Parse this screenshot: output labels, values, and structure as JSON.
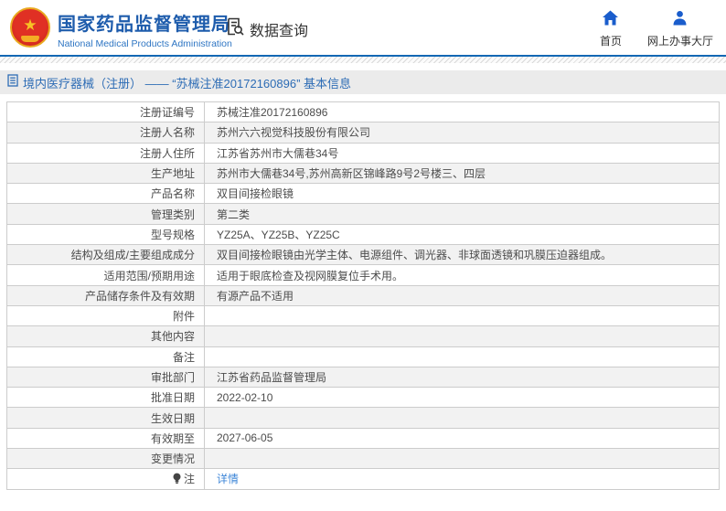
{
  "header": {
    "org_name_cn": "国家药品监督管理局",
    "org_name_en": "National Medical Products Administration",
    "section_title": "数据查询",
    "nav": [
      {
        "label": "首页"
      },
      {
        "label": "网上办事大厅"
      }
    ]
  },
  "breadcrumb": {
    "text": "境内医疗器械（注册） —— “苏械注准20172160896” 基本信息"
  },
  "table": {
    "rows": [
      {
        "label": "注册证编号",
        "value": "苏械注准20172160896"
      },
      {
        "label": "注册人名称",
        "value": "苏州六六视觉科技股份有限公司"
      },
      {
        "label": "注册人住所",
        "value": "江苏省苏州市大儒巷34号"
      },
      {
        "label": "生产地址",
        "value": "苏州市大儒巷34号,苏州高新区锦峰路9号2号楼三、四层"
      },
      {
        "label": "产品名称",
        "value": "双目间接检眼镜"
      },
      {
        "label": "管理类别",
        "value": "第二类"
      },
      {
        "label": "型号规格",
        "value": "YZ25A、YZ25B、YZ25C"
      },
      {
        "label": "结构及组成/主要组成成分",
        "value": "双目间接检眼镜由光学主体、电源组件、调光器、非球面透镜和巩膜压迫器组成。"
      },
      {
        "label": "适用范围/预期用途",
        "value": "适用于眼底检查及视网膜复位手术用。"
      },
      {
        "label": "产品储存条件及有效期",
        "value": "有源产品不适用"
      },
      {
        "label": "附件",
        "value": ""
      },
      {
        "label": "其他内容",
        "value": ""
      },
      {
        "label": "备注",
        "value": ""
      },
      {
        "label": "审批部门",
        "value": "江苏省药品监督管理局"
      },
      {
        "label": "批准日期",
        "value": "2022-02-10"
      },
      {
        "label": "生效日期",
        "value": ""
      },
      {
        "label": "有效期至",
        "value": "2027-06-05"
      },
      {
        "label": "变更情况",
        "value": ""
      },
      {
        "label": "注",
        "value": "详情",
        "icon": "bulb-icon",
        "link": true
      }
    ]
  },
  "colors": {
    "brand_blue": "#1e5cac",
    "nav_icon_blue": "#1a5dcc",
    "accent_bar_blue": "#1368b4",
    "breadcrumb_text_blue": "#2d6cb5",
    "link_blue": "#3f87d8",
    "row_alt_gray": "#f2f2f2",
    "emblem_red": "#d5281e",
    "emblem_gold": "#f7c325"
  }
}
